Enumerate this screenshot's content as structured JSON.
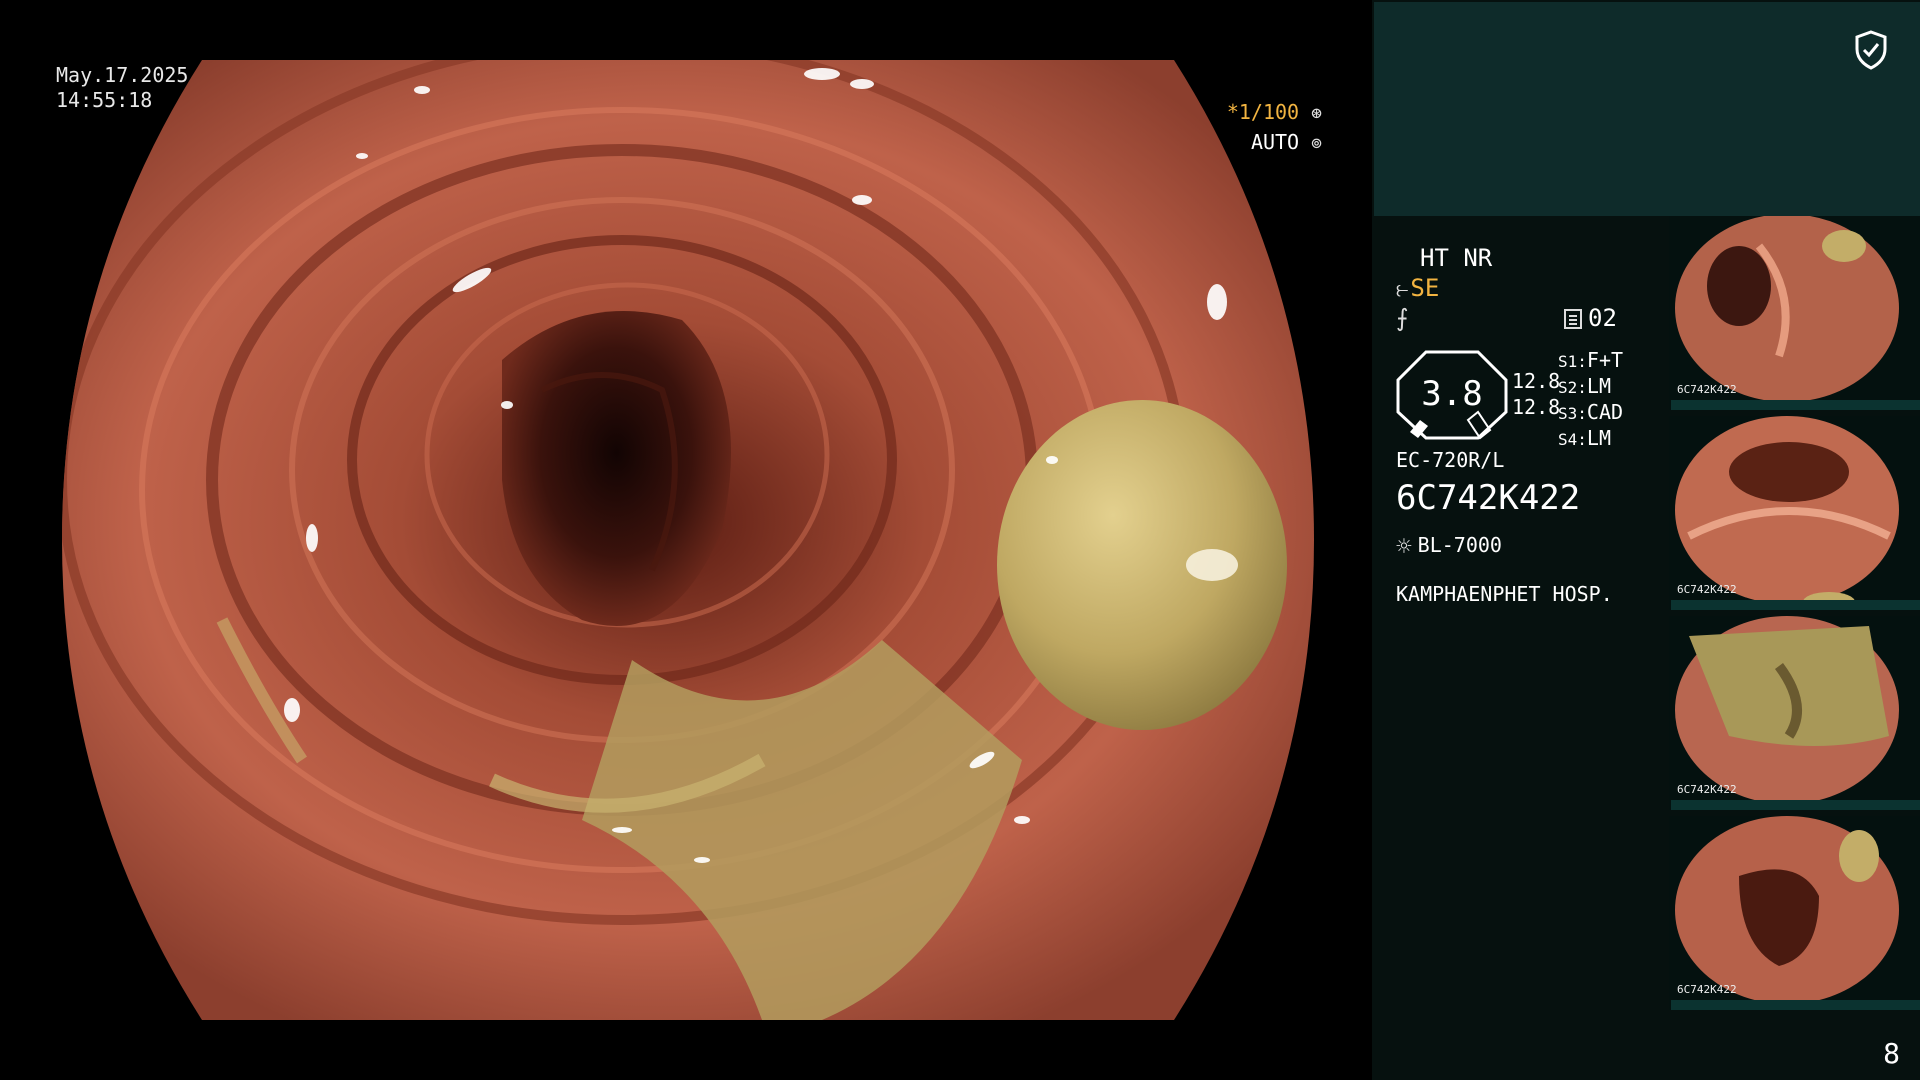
{
  "overlay": {
    "date": "May.17.2025",
    "time": "14:55:18",
    "shutter_prefix": "*",
    "shutter": "1/100",
    "iris_mode": "AUTO"
  },
  "settings": {
    "modes": "HT NR",
    "enhancement": "SE",
    "memory_icon": "memory-icon",
    "memory": "02",
    "gain_value": "3.8",
    "value_1": "12.8",
    "value_2": "12.8",
    "scope_settings": [
      {
        "label": "S1:",
        "value": "F+T"
      },
      {
        "label": "S2:",
        "value": "LM"
      },
      {
        "label": "S3:",
        "value": "CAD"
      },
      {
        "label": "S4:",
        "value": "LM"
      }
    ],
    "model": "EC-720R/L",
    "serial": "6C742K422",
    "light_source": "BL-7000",
    "hospital": "KAMPHAENPHET HOSP."
  },
  "thumbnails": [
    {
      "id": "6C742K422"
    },
    {
      "id": "6C742K422"
    },
    {
      "id": "6C742K422"
    },
    {
      "id": "6C742K422"
    }
  ],
  "page_number": "8",
  "colors": {
    "accent": "#f2b441",
    "sidebar_bg": "#06110f",
    "sidebar_top": "#0e2b2a",
    "mucosa": "#b45c44",
    "lumen": "#1e0806",
    "debris": "#c3b06e"
  }
}
